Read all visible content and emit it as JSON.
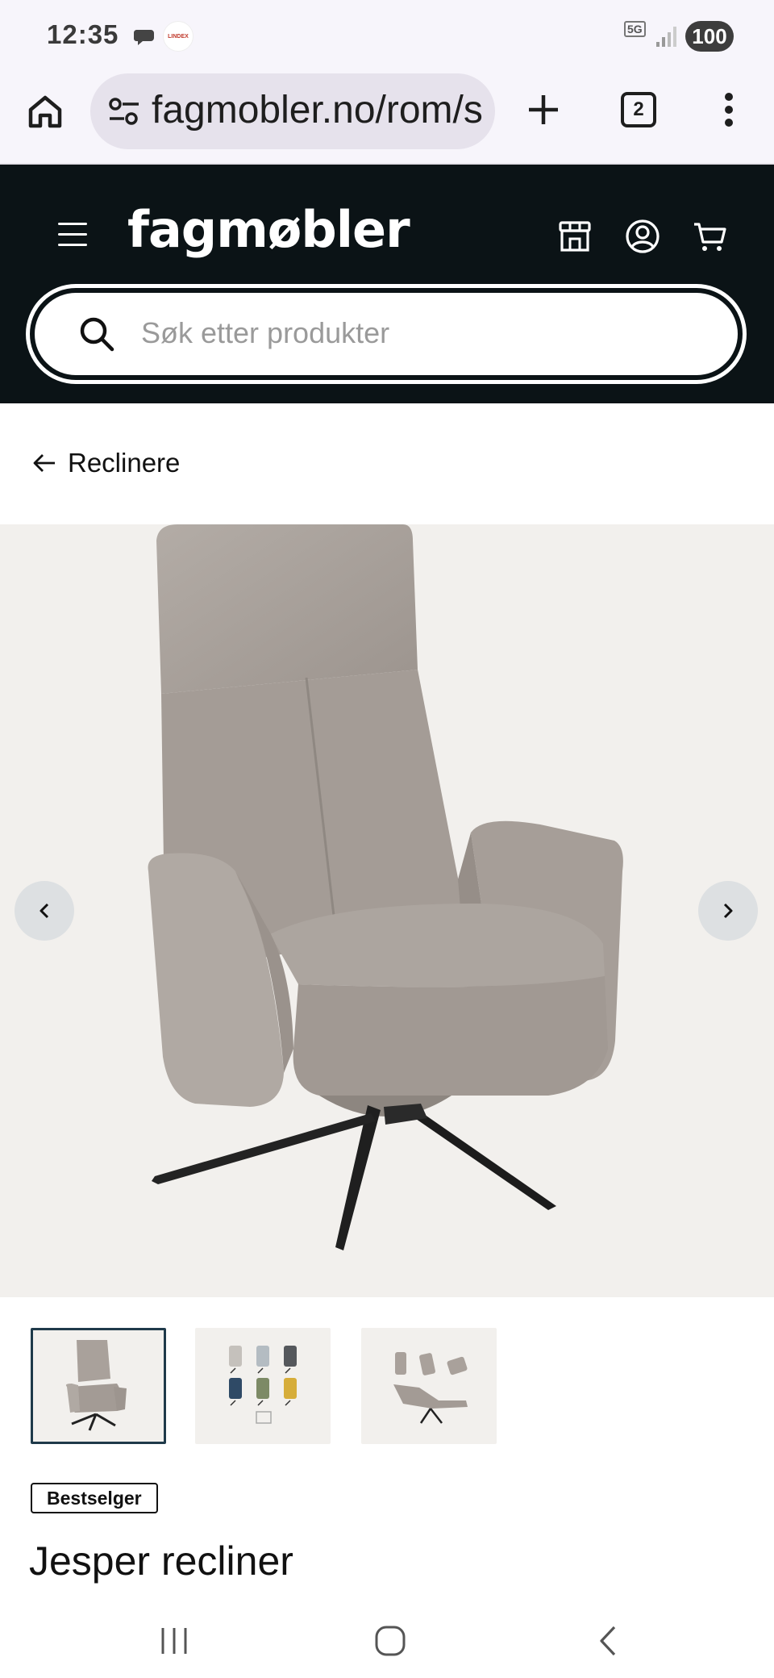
{
  "status_bar": {
    "time": "12:35",
    "app_badge": "LINDEX",
    "network": "5G",
    "battery": "100"
  },
  "browser": {
    "url": "fagmobler.no/rom/s",
    "tab_count": "2"
  },
  "header": {
    "logo": "fagmøbler",
    "search_placeholder": "Søk etter produkter"
  },
  "breadcrumb": {
    "back_label": "Reclinere"
  },
  "gallery": {
    "thumbnail_count": 3,
    "active_index": 0
  },
  "product": {
    "badge": "Bestselger",
    "title": "Jesper recliner"
  },
  "colors": {
    "header_bg": "#0b1316",
    "gallery_bg": "#f2f0ed",
    "fabric": "#a9a19b",
    "active_thumb_border": "#1f3a4a"
  }
}
